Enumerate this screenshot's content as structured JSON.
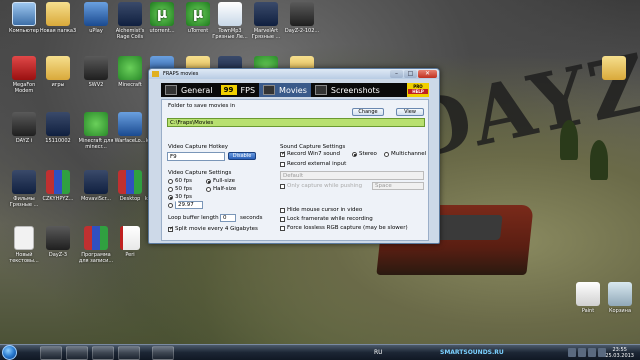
{
  "desktop": {
    "wallpaper_text": "DAYZ",
    "icons": [
      {
        "label": "Компьютер",
        "glyph": "g-computer",
        "name": "computer-icon"
      },
      {
        "label": "Новая папка3",
        "glyph": "g-folder",
        "name": "folder-icon"
      },
      {
        "label": "uPlay",
        "glyph": "g-blue",
        "name": "uplay-icon"
      },
      {
        "label": "Alchemist's Rage Coils",
        "glyph": "g-video",
        "name": "game-icon"
      },
      {
        "label": "utorrent...",
        "glyph": "g-utorrent",
        "name": "utorrent-icon"
      },
      {
        "label": "uTorrent",
        "glyph": "g-utorrent",
        "name": "utorrent-icon"
      },
      {
        "label": "TownMp3 Грязные Ле...",
        "glyph": "g-music",
        "name": "mp3-file-icon"
      },
      {
        "label": "MarvelArt Грязные ...",
        "glyph": "g-video",
        "name": "video-file-icon"
      },
      {
        "label": "DayZ-2-102...",
        "glyph": "g-dark",
        "name": "dayz-icon"
      },
      {
        "label": "MegaFon Modem",
        "glyph": "g-red",
        "name": "megafon-icon"
      },
      {
        "label": "игры",
        "glyph": "g-folder",
        "name": "folder-icon"
      },
      {
        "label": "SWV2",
        "glyph": "g-dark",
        "name": "game-icon"
      },
      {
        "label": "Minecraft",
        "glyph": "g-green",
        "name": "minecraft-icon"
      },
      {
        "label": "MultiFon",
        "glyph": "g-blue",
        "name": "multifon-icon"
      },
      {
        "label": "Новая папка",
        "glyph": "g-folder",
        "name": "folder-icon"
      },
      {
        "label": "14290001",
        "glyph": "g-video",
        "name": "video-file-icon"
      },
      {
        "label": "minecraft",
        "glyph": "g-green",
        "name": "minecraft-icon"
      },
      {
        "label": "фотки",
        "glyph": "g-folder",
        "name": "folder-icon"
      },
      {
        "label": "DAYZ i",
        "glyph": "g-dark",
        "name": "dayz-icon"
      },
      {
        "label": "15110002",
        "glyph": "g-video",
        "name": "video-file-icon"
      },
      {
        "label": "Minecraft для minecr...",
        "glyph": "g-green",
        "name": "minecraft-icon"
      },
      {
        "label": "WarfaceLo...",
        "glyph": "g-blue",
        "name": "warface-icon"
      },
      {
        "label": "kis13.0.1.4...",
        "glyph": "g-red",
        "name": "kaspersky-icon"
      },
      {
        "label": "Peri",
        "glyph": "g-winrar",
        "name": "winrar-icon"
      },
      {
        "label": "Skype",
        "glyph": "g-winrar",
        "name": "winrar-icon"
      },
      {
        "label": "иukoзинн Information...",
        "glyph": "g-file",
        "name": "file-icon"
      },
      {
        "label": "je-7u17-w...",
        "glyph": "g-winrar",
        "name": "winrar-icon"
      },
      {
        "label": "Фильмы Грязные ...",
        "glyph": "g-video",
        "name": "video-file-icon"
      },
      {
        "label": "CZKYHPYZ...",
        "glyph": "g-winrar",
        "name": "winrar-icon"
      },
      {
        "label": "MovaviScr...",
        "glyph": "g-video",
        "name": "movavi-icon"
      },
      {
        "label": "Desktop",
        "glyph": "g-winrar",
        "name": "winrar-icon"
      },
      {
        "label": "kav13.0.1.4...",
        "glyph": "g-red",
        "name": "kaspersky-icon"
      },
      {
        "label": "Steam",
        "glyph": "g-steam",
        "name": "steam-icon"
      },
      {
        "label": "Skype",
        "glyph": "g-folder",
        "name": "folder-icon"
      },
      {
        "label": "EBA Police - Весь Ми...",
        "glyph": "g-file",
        "name": "file-icon"
      },
      {
        "label": "Dan Balan - Весь Ми...",
        "glyph": "g-file",
        "name": "file-icon"
      },
      {
        "label": "Новый текстовы...",
        "glyph": "g-file",
        "name": "text-file-icon"
      },
      {
        "label": "DayZ-3",
        "glyph": "g-dark",
        "name": "dayz-icon"
      },
      {
        "label": "Программа для записи...",
        "glyph": "g-winrar",
        "name": "winrar-icon"
      },
      {
        "label": "Peri",
        "glyph": "g-pdf",
        "name": "pdf-icon"
      },
      {
        "label": "Paint",
        "glyph": "g-paint",
        "name": "paint-icon"
      },
      {
        "label": "Корзина",
        "glyph": "g-trash",
        "name": "recycle-bin-icon"
      },
      {
        "label": "",
        "glyph": "g-folder",
        "name": "folder-icon"
      }
    ]
  },
  "fraps": {
    "title": "FRAPS movies",
    "tabs": {
      "general": "General",
      "fps_badge": "99",
      "fps": "FPS",
      "movies": "Movies",
      "screenshots": "Screenshots"
    },
    "help_top": "PRO",
    "help": "HELP",
    "help_sub": "",
    "folder_label": "Folder to save movies in",
    "change_btn": "Change",
    "view_btn": "View",
    "folder_path": "C:\\Fraps\\Movies",
    "hotkey_label": "Video Capture Hotkey",
    "hotkey_value": "F9",
    "disable_btn": "Disable",
    "settings_label": "Video Capture Settings",
    "fps60": "60 fps",
    "fps50": "50 fps",
    "fps30": "30 fps",
    "fps_custom": "29.97",
    "full_size": "Full-size",
    "half_size": "Half-size",
    "loop_label": "Loop buffer length",
    "loop_value": "0",
    "loop_unit": "seconds",
    "split_label": "Split movie every 4 Gigabytes",
    "sound_label": "Sound Capture Settings",
    "record_win7": "Record Win7 sound",
    "stereo": "Stereo",
    "multichannel": "Multichannel",
    "record_external": "Record external input",
    "external_default": "Default",
    "push_to_talk": "Only capture while pushing",
    "push_key": "Space",
    "hide_cursor": "Hide mouse cursor in video",
    "lock_framerate": "Lock framerate while recording",
    "force_rgb": "Force lossless RGB capture (may be slower)"
  },
  "taskbar": {
    "lang": "RU",
    "time": "23:55",
    "date": "25.03.2013",
    "watermark": "SMARTSOUNDS.RU"
  }
}
